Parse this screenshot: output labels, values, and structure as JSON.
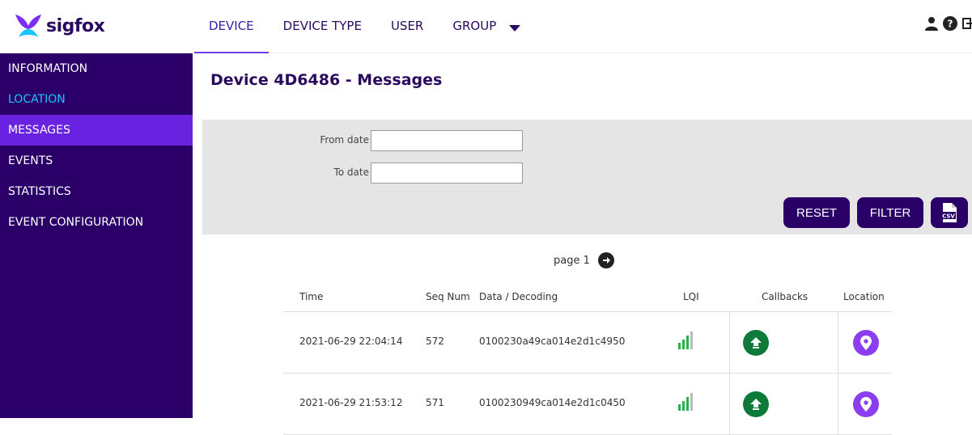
{
  "app": {
    "logo_text": "sigfox"
  },
  "nav": {
    "items": [
      {
        "label": "DEVICE"
      },
      {
        "label": "DEVICE TYPE"
      },
      {
        "label": "USER"
      },
      {
        "label": "GROUP"
      }
    ]
  },
  "sidebar": {
    "items": [
      {
        "label": "INFORMATION"
      },
      {
        "label": "LOCATION"
      },
      {
        "label": "MESSAGES"
      },
      {
        "label": "EVENTS"
      },
      {
        "label": "STATISTICS"
      },
      {
        "label": "EVENT CONFIGURATION"
      }
    ]
  },
  "page": {
    "title": "Device 4D6486 - Messages"
  },
  "filter": {
    "from_label": "From date",
    "from_value": "",
    "to_label": "To date",
    "to_value": "",
    "reset_label": "RESET",
    "filter_label": "FILTER"
  },
  "pager": {
    "label": "page 1"
  },
  "table": {
    "headers": {
      "time": "Time",
      "seq": "Seq Num",
      "data": "Data / Decoding",
      "lqi": "LQI",
      "callbacks": "Callbacks",
      "location": "Location"
    },
    "rows": [
      {
        "time": "2021-06-29 22:04:14",
        "seq": "572",
        "data": "0100230a49ca014e2d1c4950",
        "lqi_bars": 3
      },
      {
        "time": "2021-06-29 21:53:12",
        "seq": "571",
        "data": "0100230949ca014e2d1c0450",
        "lqi_bars": 3
      }
    ]
  },
  "colors": {
    "sidebar_bg": "#2a0068",
    "sidebar_active": "#6923e0",
    "link": "#19c4ff",
    "callback_ok": "#0d7a3a",
    "location": "#8b3df0",
    "lqi_good": "#28b34a"
  },
  "icons": [
    "logo-icon",
    "user-icon",
    "help-icon",
    "logout-icon",
    "csv-file-icon",
    "next-page-icon",
    "upload-arrow-icon",
    "location-pin-icon"
  ]
}
